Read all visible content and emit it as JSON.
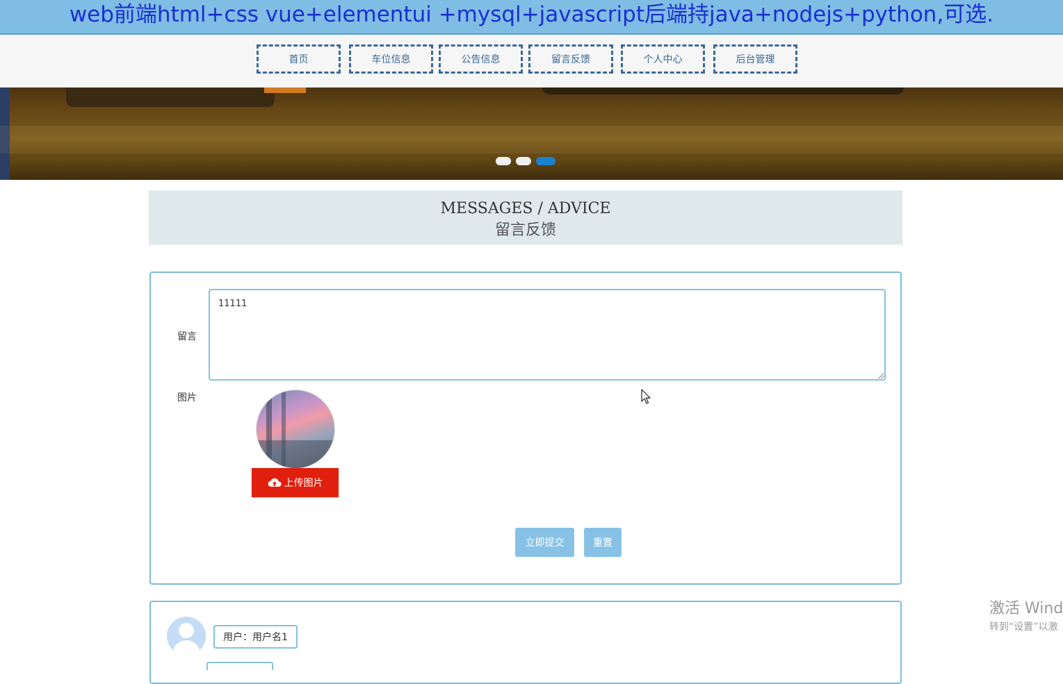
{
  "top_banner": {
    "text": "web前端html+css vue+elementui +mysql+javascript后端持java+nodejs+python,可选."
  },
  "nav": {
    "items": [
      {
        "label": "首页"
      },
      {
        "label": "车位信息"
      },
      {
        "label": "公告信息"
      },
      {
        "label": "留言反馈"
      },
      {
        "label": "个人中心"
      },
      {
        "label": "后台管理"
      }
    ]
  },
  "carousel": {
    "dot_count": 3,
    "active_index": 2,
    "active_color": "#1a82d0"
  },
  "section": {
    "title_en": "MESSAGES / ADVICE",
    "title_cn": "留言反馈"
  },
  "form": {
    "message_label": "留言",
    "message_value": "11111",
    "image_label": "图片",
    "upload_label": "上传图片",
    "submit_label": "立即提交",
    "reset_label": "重置"
  },
  "messages": [
    {
      "user": "用户：用户名1"
    }
  ],
  "watermark": {
    "line1": "激活 Wind",
    "line2": "转到“设置”以激"
  },
  "colors": {
    "banner_bg": "#7fbde4",
    "banner_text": "#1a2fd0",
    "nav_border": "#3a6896",
    "upload_button": "#e01f0e",
    "action_button": "#87c2e6",
    "card_border": "#7fbcd8"
  },
  "icons": {
    "upload": "cloud-upload-icon",
    "avatar": "user-avatar-icon",
    "cursor": "mouse-pointer-icon"
  }
}
